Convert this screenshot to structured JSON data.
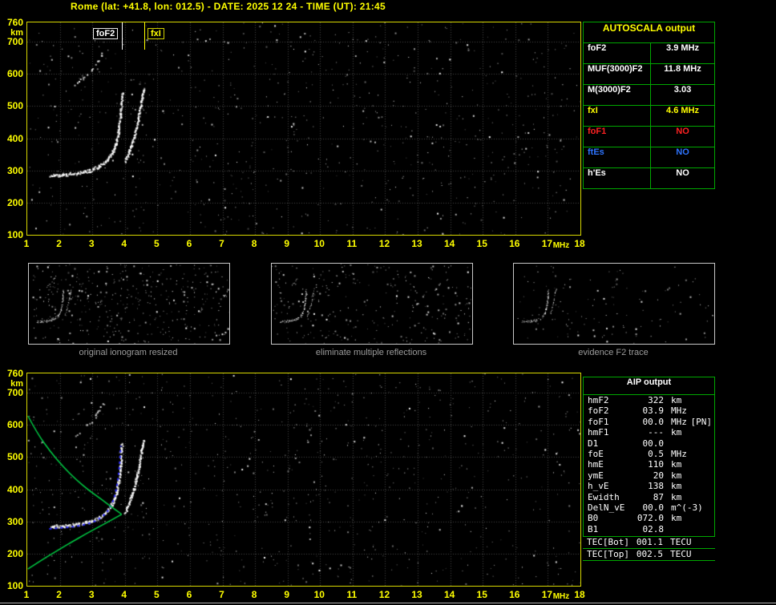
{
  "window": {
    "title": "Rome (lat: +41.8, lon: 012.5) - DATE: 2025 12 24 - TIME (UT): 21:45"
  },
  "colors": {
    "axis_yellow": "#ffff00",
    "plot_border_yellow": "#d9d900",
    "table_green": "#00a800",
    "profile_green": "#00cc44",
    "fitted_trace_blue": "#2a2aff",
    "alert_red": "#ff2222",
    "info_blue": "#2e74ff",
    "caption_gray": "#9c9c9c",
    "grid_gray": "#464646"
  },
  "ionogram_axes": {
    "f_min": 1,
    "f_max": 18,
    "km_min": 100,
    "km_max": 760,
    "x_ticks": [
      1,
      2,
      3,
      4,
      5,
      6,
      7,
      8,
      9,
      10,
      11,
      12,
      13,
      14,
      15,
      16,
      17,
      18
    ],
    "x_unit": "MHz",
    "y_ticks": [
      760,
      700,
      600,
      500,
      400,
      300,
      200,
      100
    ],
    "y_unit": "km"
  },
  "markers": {
    "fof2_label": "foF2",
    "fof2_mhz": 3.9,
    "fxi_label": "fxI",
    "fxi_mhz": 4.6
  },
  "chart_data": {
    "type": "scatter",
    "title": "Ionogram: virtual height (km) vs sounding frequency (MHz)",
    "xlabel": "MHz",
    "ylabel": "km",
    "xlim": [
      1,
      18
    ],
    "ylim": [
      100,
      760
    ],
    "traces": {
      "f2_ordinary": [
        [
          1.7,
          287
        ],
        [
          2.1,
          290
        ],
        [
          2.5,
          294
        ],
        [
          2.9,
          302
        ],
        [
          3.2,
          315
        ],
        [
          3.45,
          335
        ],
        [
          3.6,
          358
        ],
        [
          3.72,
          390
        ],
        [
          3.8,
          430
        ],
        [
          3.86,
          480
        ],
        [
          3.9,
          545
        ]
      ],
      "f2_extraordinary": [
        [
          3.98,
          330
        ],
        [
          4.12,
          360
        ],
        [
          4.27,
          405
        ],
        [
          4.4,
          465
        ],
        [
          4.5,
          520
        ],
        [
          4.56,
          555
        ]
      ],
      "multiple_reflection": [
        [
          2.45,
          565
        ],
        [
          2.7,
          588
        ],
        [
          2.95,
          612
        ],
        [
          3.15,
          640
        ],
        [
          3.3,
          668
        ]
      ]
    },
    "profile": {
      "topside": [
        [
          1.02,
          628
        ],
        [
          1.3,
          575
        ],
        [
          1.7,
          518
        ],
        [
          2.1,
          470
        ],
        [
          2.5,
          430
        ],
        [
          2.9,
          396
        ],
        [
          3.3,
          367
        ],
        [
          3.6,
          344
        ],
        [
          3.8,
          330
        ],
        [
          3.9,
          322
        ]
      ],
      "bottomside": [
        [
          3.9,
          322
        ],
        [
          3.6,
          305
        ],
        [
          3.2,
          283
        ],
        [
          2.8,
          261
        ],
        [
          2.4,
          238
        ],
        [
          2.0,
          214
        ],
        [
          1.6,
          190
        ],
        [
          1.2,
          164
        ],
        [
          1.02,
          152
        ]
      ]
    }
  },
  "autoscala": {
    "header": "AUTOSCALA output",
    "rows": [
      {
        "label": "foF2",
        "value": "3.9 MHz",
        "color": "#ffffff"
      },
      {
        "label": "MUF(3000)F2",
        "value": "11.8 MHz",
        "color": "#ffffff"
      },
      {
        "label": "M(3000)F2",
        "value": "3.03",
        "color": "#ffffff"
      },
      {
        "label": "fxI",
        "value": "4.6 MHz",
        "color": "#ffff00"
      },
      {
        "label": "foF1",
        "value": "NO",
        "color": "#ff2222"
      },
      {
        "label": "ftEs",
        "value": "NO",
        "color": "#2e74ff"
      },
      {
        "label": "h'Es",
        "value": "NO",
        "color": "#ffffff"
      }
    ]
  },
  "thumbnails": [
    {
      "caption": "original ionogram resized"
    },
    {
      "caption": "eliminate multiple reflections"
    },
    {
      "caption": "evidence F2 trace"
    }
  ],
  "aip": {
    "header": "AIP output",
    "rows": [
      {
        "name": "hmF2",
        "value": "322",
        "unit": "km"
      },
      {
        "name": "foF2",
        "value": "03.9",
        "unit": "MHz"
      },
      {
        "name": "foF1",
        "value": "00.0",
        "unit": "MHz",
        "extra": "[PN]"
      },
      {
        "name": "hmF1",
        "value": "---",
        "unit": "km"
      },
      {
        "name": "D1",
        "value": "00.0",
        "unit": ""
      },
      {
        "name": "foE",
        "value": "0.5",
        "unit": "MHz"
      },
      {
        "name": "hmE",
        "value": "110",
        "unit": "km"
      },
      {
        "name": "ymE",
        "value": "20",
        "unit": "km"
      },
      {
        "name": "h_vE",
        "value": "138",
        "unit": "km"
      },
      {
        "name": "Ewidth",
        "value": "87",
        "unit": "km"
      },
      {
        "name": "DelN_vE",
        "value": "00.0",
        "unit": "m^(-3)"
      },
      {
        "name": "B0",
        "value": "072.0",
        "unit": "km"
      },
      {
        "name": "B1",
        "value": "02.8",
        "unit": ""
      },
      {
        "name": "TEC[Bot]",
        "value": "001.1",
        "unit": "TECU",
        "tec": true
      },
      {
        "name": "TEC[Top]",
        "value": "002.5",
        "unit": "TECU",
        "tec": true
      }
    ]
  }
}
